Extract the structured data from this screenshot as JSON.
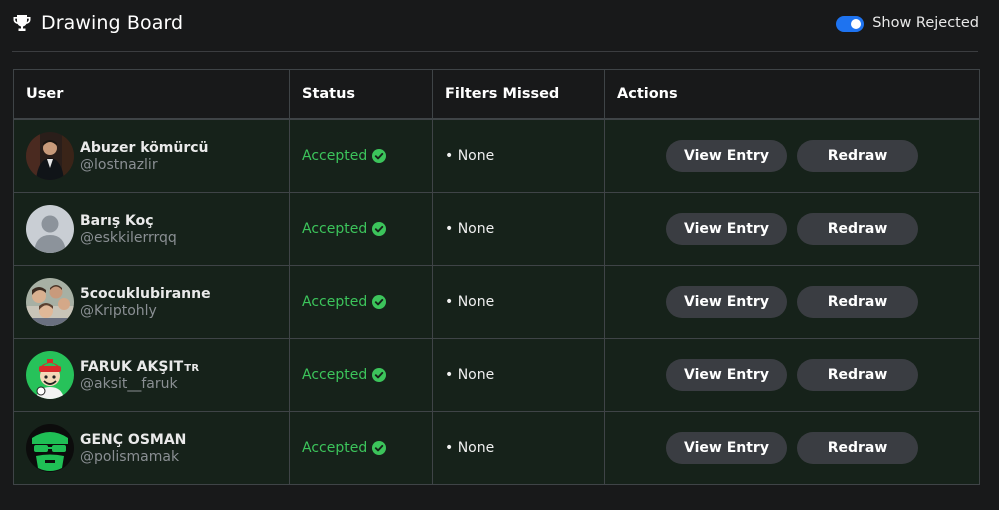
{
  "header": {
    "title": "Drawing Board",
    "icon": "trophy-icon",
    "toggle_label": "Show Rejected",
    "toggle_on": true
  },
  "table": {
    "columns": [
      "User",
      "Status",
      "Filters Missed",
      "Actions"
    ],
    "rows": [
      {
        "name": "Abuzer kömürcü",
        "handle": "@lostnazlir",
        "status": "Accepted",
        "filters": "• None",
        "view_label": "View Entry",
        "redraw_label": "Redraw"
      },
      {
        "name": "Barış Koç",
        "handle": "@eskkilerrrqq",
        "status": "Accepted",
        "filters": "• None",
        "view_label": "View Entry",
        "redraw_label": "Redraw"
      },
      {
        "name": "5cocuklubiranne",
        "handle": "@Kriptohly",
        "status": "Accepted",
        "filters": "• None",
        "view_label": "View Entry",
        "redraw_label": "Redraw"
      },
      {
        "name": "FARUK AKŞIT",
        "name_badge": "TR",
        "handle": "@aksit__faruk",
        "status": "Accepted",
        "filters": "• None",
        "view_label": "View Entry",
        "redraw_label": "Redraw"
      },
      {
        "name": "GENÇ OSMAN",
        "handle": "@polismamak",
        "status": "Accepted",
        "filters": "• None",
        "view_label": "View Entry",
        "redraw_label": "Redraw"
      }
    ]
  },
  "colors": {
    "accepted": "#3cc45b",
    "toggle": "#1e73f0",
    "row_bg": "#16221a",
    "button_bg": "#3a3d42"
  }
}
